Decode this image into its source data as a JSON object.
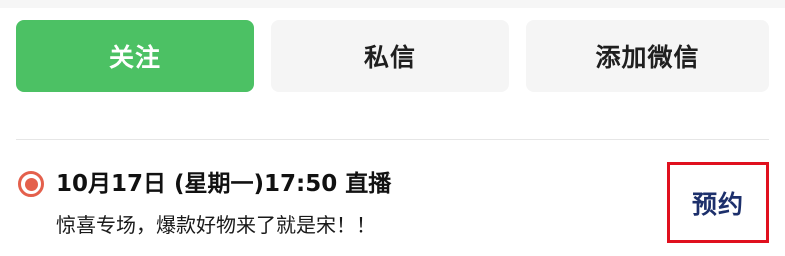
{
  "actions": {
    "follow_label": "关注",
    "message_label": "私信",
    "add_wechat_label": "添加微信"
  },
  "live": {
    "icon": "live-record-icon",
    "title": "10月17日 (星期一)17:50 直播",
    "description": "惊喜专场，爆款好物来了就是宋！！",
    "reserve_label": "预约"
  },
  "colors": {
    "follow_green": "#4cc164",
    "secondary_button_bg": "#f5f5f5",
    "live_icon_red": "#e4604c",
    "reserve_text": "#1c2f6b",
    "highlight_box": "#e0101e"
  }
}
